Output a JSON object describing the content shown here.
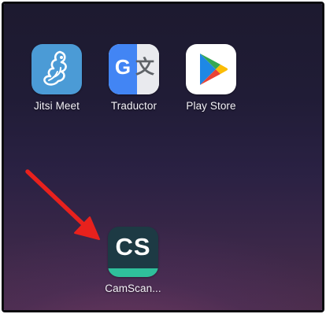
{
  "home_screen": {
    "apps": [
      {
        "label": "Jitsi Meet",
        "icon": "jitsi-meet-icon"
      },
      {
        "label": "Traductor",
        "icon": "google-translate-icon",
        "glyphs": [
          "G",
          "文"
        ]
      },
      {
        "label": "Play Store",
        "icon": "play-store-icon"
      },
      {
        "label": "CamScan...",
        "icon": "camscanner-icon",
        "glyph": "CS"
      }
    ]
  },
  "annotation": {
    "type": "arrow",
    "color": "#e8211d",
    "points_to": "CamScan..."
  },
  "colors": {
    "jitsi_bg": "#4b9bd6",
    "translate_blue": "#4285f4",
    "camscanner_bg": "#1d3a44",
    "camscanner_accent": "#2fc09b"
  }
}
